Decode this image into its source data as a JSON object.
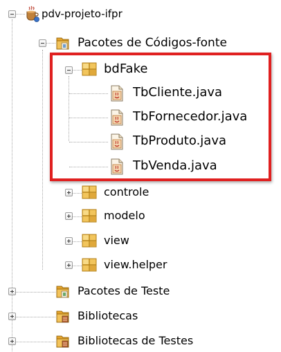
{
  "tree": {
    "project": {
      "label": "pdv-projeto-ifpr",
      "icon": "coffee-cup-project-icon"
    },
    "source_packages": {
      "label": "Pacotes de Códigos-fonte",
      "icon": "source-folder-icon"
    },
    "packages": [
      {
        "label": "bdFake",
        "icon": "package-icon"
      },
      {
        "label": "controle",
        "icon": "package-icon"
      },
      {
        "label": "modelo",
        "icon": "package-icon"
      },
      {
        "label": "view",
        "icon": "package-icon"
      },
      {
        "label": "view.helper",
        "icon": "package-icon"
      }
    ],
    "files": [
      {
        "label": "TbCliente.java",
        "icon": "java-file-icon"
      },
      {
        "label": "TbFornecedor.java",
        "icon": "java-file-icon"
      },
      {
        "label": "TbProduto.java",
        "icon": "java-file-icon"
      },
      {
        "label": "TbVenda.java",
        "icon": "java-file-icon"
      }
    ],
    "bottom": [
      {
        "label": "Pacotes de Teste",
        "icon": "test-folder-icon"
      },
      {
        "label": "Bibliotecas",
        "icon": "library-folder-icon"
      },
      {
        "label": "Bibliotecas de Testes",
        "icon": "library-folder-icon"
      }
    ]
  },
  "highlight_color": "#e02020"
}
